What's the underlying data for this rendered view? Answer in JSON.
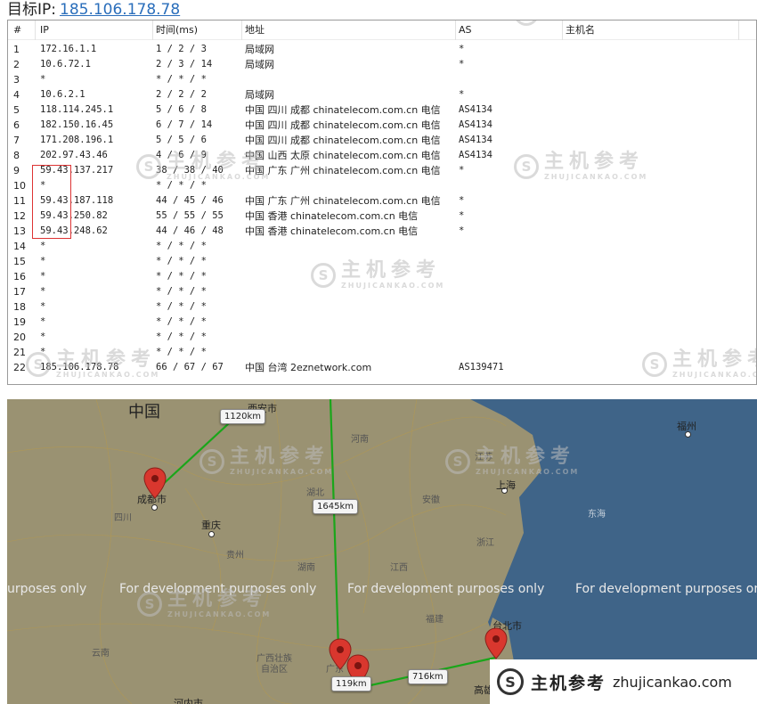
{
  "header": {
    "label": "目标IP:",
    "ip": "185.106.178.78"
  },
  "table": {
    "columns": [
      "#",
      "IP",
      "时间(ms)",
      "地址",
      "AS",
      "主机名"
    ],
    "rows": [
      [
        "1",
        "172.16.1.1",
        "1 / 2 / 3",
        "局域网",
        "*",
        ""
      ],
      [
        "2",
        "10.6.72.1",
        "2 / 3 / 14",
        "局域网",
        "*",
        ""
      ],
      [
        "3",
        "*",
        "* / * / *",
        "",
        "",
        ""
      ],
      [
        "4",
        "10.6.2.1",
        "2 / 2 / 2",
        "局域网",
        "*",
        ""
      ],
      [
        "5",
        "118.114.245.1",
        "5 / 6 / 8",
        "中国 四川 成都 chinatelecom.com.cn 电信",
        "AS4134",
        ""
      ],
      [
        "6",
        "182.150.16.45",
        "6 / 7 / 14",
        "中国 四川 成都 chinatelecom.com.cn 电信",
        "AS4134",
        ""
      ],
      [
        "7",
        "171.208.196.1",
        "5 / 5 / 6",
        "中国 四川 成都 chinatelecom.com.cn 电信",
        "AS4134",
        ""
      ],
      [
        "8",
        "202.97.43.46",
        "4 / 6 / 9",
        "中国 山西 太原 chinatelecom.com.cn 电信",
        "AS4134",
        ""
      ],
      [
        "9",
        "59.43.137.217",
        "38 / 38 / 40",
        "中国 广东 广州 chinatelecom.com.cn 电信",
        "*",
        ""
      ],
      [
        "10",
        "*",
        "* / * / *",
        "",
        "",
        ""
      ],
      [
        "11",
        "59.43.187.118",
        "44 / 45 / 46",
        "中国 广东 广州 chinatelecom.com.cn 电信",
        "*",
        ""
      ],
      [
        "12",
        "59.43.250.82",
        "55 / 55 / 55",
        "中国 香港 chinatelecom.com.cn 电信",
        "*",
        ""
      ],
      [
        "13",
        "59.43.248.62",
        "44 / 46 / 48",
        "中国 香港 chinatelecom.com.cn 电信",
        "*",
        ""
      ],
      [
        "14",
        "*",
        "* / * / *",
        "",
        "",
        ""
      ],
      [
        "15",
        "*",
        "* / * / *",
        "",
        "",
        ""
      ],
      [
        "16",
        "*",
        "* / * / *",
        "",
        "",
        ""
      ],
      [
        "17",
        "*",
        "* / * / *",
        "",
        "",
        ""
      ],
      [
        "18",
        "*",
        "* / * / *",
        "",
        "",
        ""
      ],
      [
        "19",
        "*",
        "* / * / *",
        "",
        "",
        ""
      ],
      [
        "20",
        "*",
        "* / * / *",
        "",
        "",
        ""
      ],
      [
        "21",
        "*",
        "* / * / *",
        "",
        "",
        ""
      ],
      [
        "22",
        "185.106.178.78",
        "66 / 67 / 67",
        "中国 台湾 2eznetwork.com",
        "AS139471",
        ""
      ]
    ]
  },
  "watermark": {
    "zh": "主机参考",
    "en": "ZHUJICANKAO.COM",
    "logo_glyph": "S"
  },
  "map": {
    "country_label": "中国",
    "cities": [
      {
        "id": "chengdu",
        "name": "成都市"
      },
      {
        "id": "chongqing",
        "name": "重庆"
      },
      {
        "id": "shanghai",
        "name": "上海"
      },
      {
        "id": "fuzhou",
        "name": "福州"
      },
      {
        "id": "taibei",
        "name": "台北市"
      },
      {
        "id": "xian",
        "name": "西安市"
      },
      {
        "id": "hekou",
        "name": "河内市"
      },
      {
        "id": "kaohsiung",
        "name": "高雄"
      }
    ],
    "provinces": [
      "四川",
      "贵州",
      "云南",
      "广西壮族自治区",
      "湖北",
      "河南",
      "江苏",
      "安徽",
      "浙江",
      "江西",
      "福建",
      "湖南",
      "广东"
    ],
    "sea_label": "东海",
    "distances": [
      "1120km",
      "1645km",
      "119km",
      "716km"
    ],
    "overlay_text": "For development purposes only",
    "overlay_text_partial": "urposes only",
    "colors": {
      "route": "#1aa61a",
      "marker": "#d9372e",
      "sea": "#3f6488",
      "land": "#9a9272"
    }
  },
  "brand": {
    "zh": "主机参考",
    "en": "zhujicankao.com",
    "logo_glyph": "S"
  }
}
